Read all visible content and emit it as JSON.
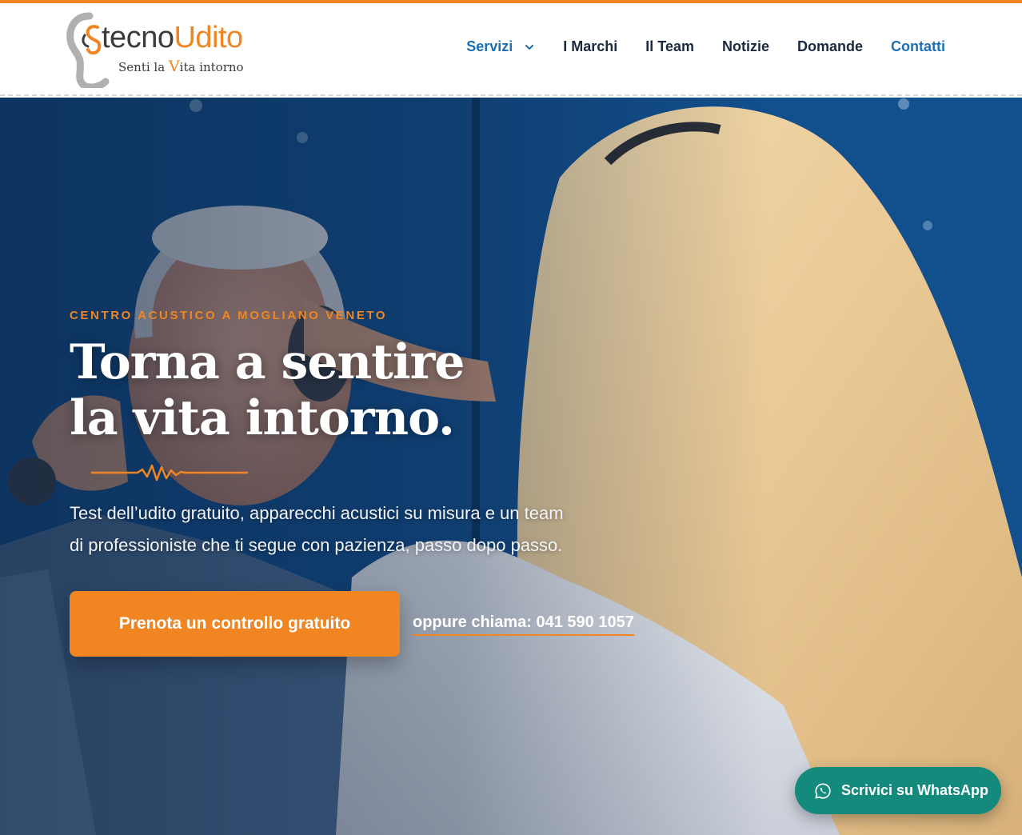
{
  "brand": {
    "logo_word_part1": "tecno",
    "logo_word_part2": "Udito",
    "tagline_part1": "Senti la ",
    "tagline_v": "V",
    "tagline_part2": "ita intorno",
    "accent_color": "#f08522",
    "dark_color": "#1b2a3f",
    "link_color": "#1d6fb5"
  },
  "nav": {
    "items": [
      {
        "label": "Servizi",
        "has_dropdown": true
      },
      {
        "label": "I Marchi"
      },
      {
        "label": "Il Team"
      },
      {
        "label": "Notizie"
      },
      {
        "label": "Domande"
      },
      {
        "label": "Contatti"
      }
    ]
  },
  "hero": {
    "eyebrow": "CENTRO ACUSTICO A MOGLIANO VENETO",
    "headline_line1": "Torna a sentire",
    "headline_line2": "la vita intorno.",
    "lead_line1": "Test dell’udito gratuito, apparecchi acustici su misura e un team",
    "lead_line2": "di professioniste che ti segue con pazienza, passo dopo passo.",
    "cta_label": "Prenota un controllo gratuito",
    "call_label": "oppure chiama: 041 590 1057",
    "background_color": "#0f4a86"
  },
  "whatsapp": {
    "label": "Scrivici su WhatsApp",
    "icon": "whatsapp-icon",
    "color": "#138a7c"
  }
}
